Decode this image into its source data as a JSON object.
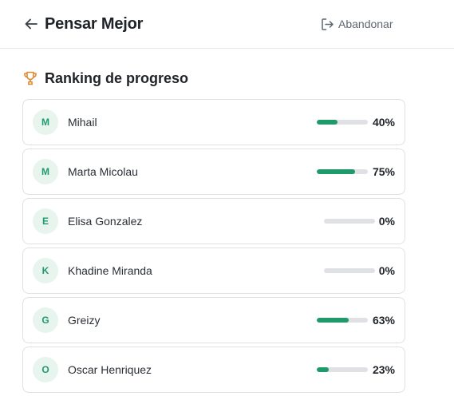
{
  "header": {
    "title": "Pensar Mejor",
    "leave_label": "Abandonar",
    "back_icon": "arrow-left-icon",
    "leave_icon": "exit-icon"
  },
  "ranking": {
    "title": "Ranking de progreso",
    "icon": "trophy-icon",
    "accent_color": "#1f9a6a",
    "trophy_color": "#e08a2e",
    "items": [
      {
        "initial": "M",
        "name": "Mihail",
        "percent_label": "40%",
        "progress": 0.4
      },
      {
        "initial": "M",
        "name": "Marta Micolau",
        "percent_label": "75%",
        "progress": 0.75
      },
      {
        "initial": "E",
        "name": "Elisa Gonzalez",
        "percent_label": "0%",
        "progress": 0.0
      },
      {
        "initial": "K",
        "name": "Khadine Miranda",
        "percent_label": "0%",
        "progress": 0.0
      },
      {
        "initial": "G",
        "name": "Greizy",
        "percent_label": "63%",
        "progress": 0.63
      },
      {
        "initial": "O",
        "name": "Oscar Henriquez",
        "percent_label": "23%",
        "progress": 0.23
      }
    ]
  }
}
